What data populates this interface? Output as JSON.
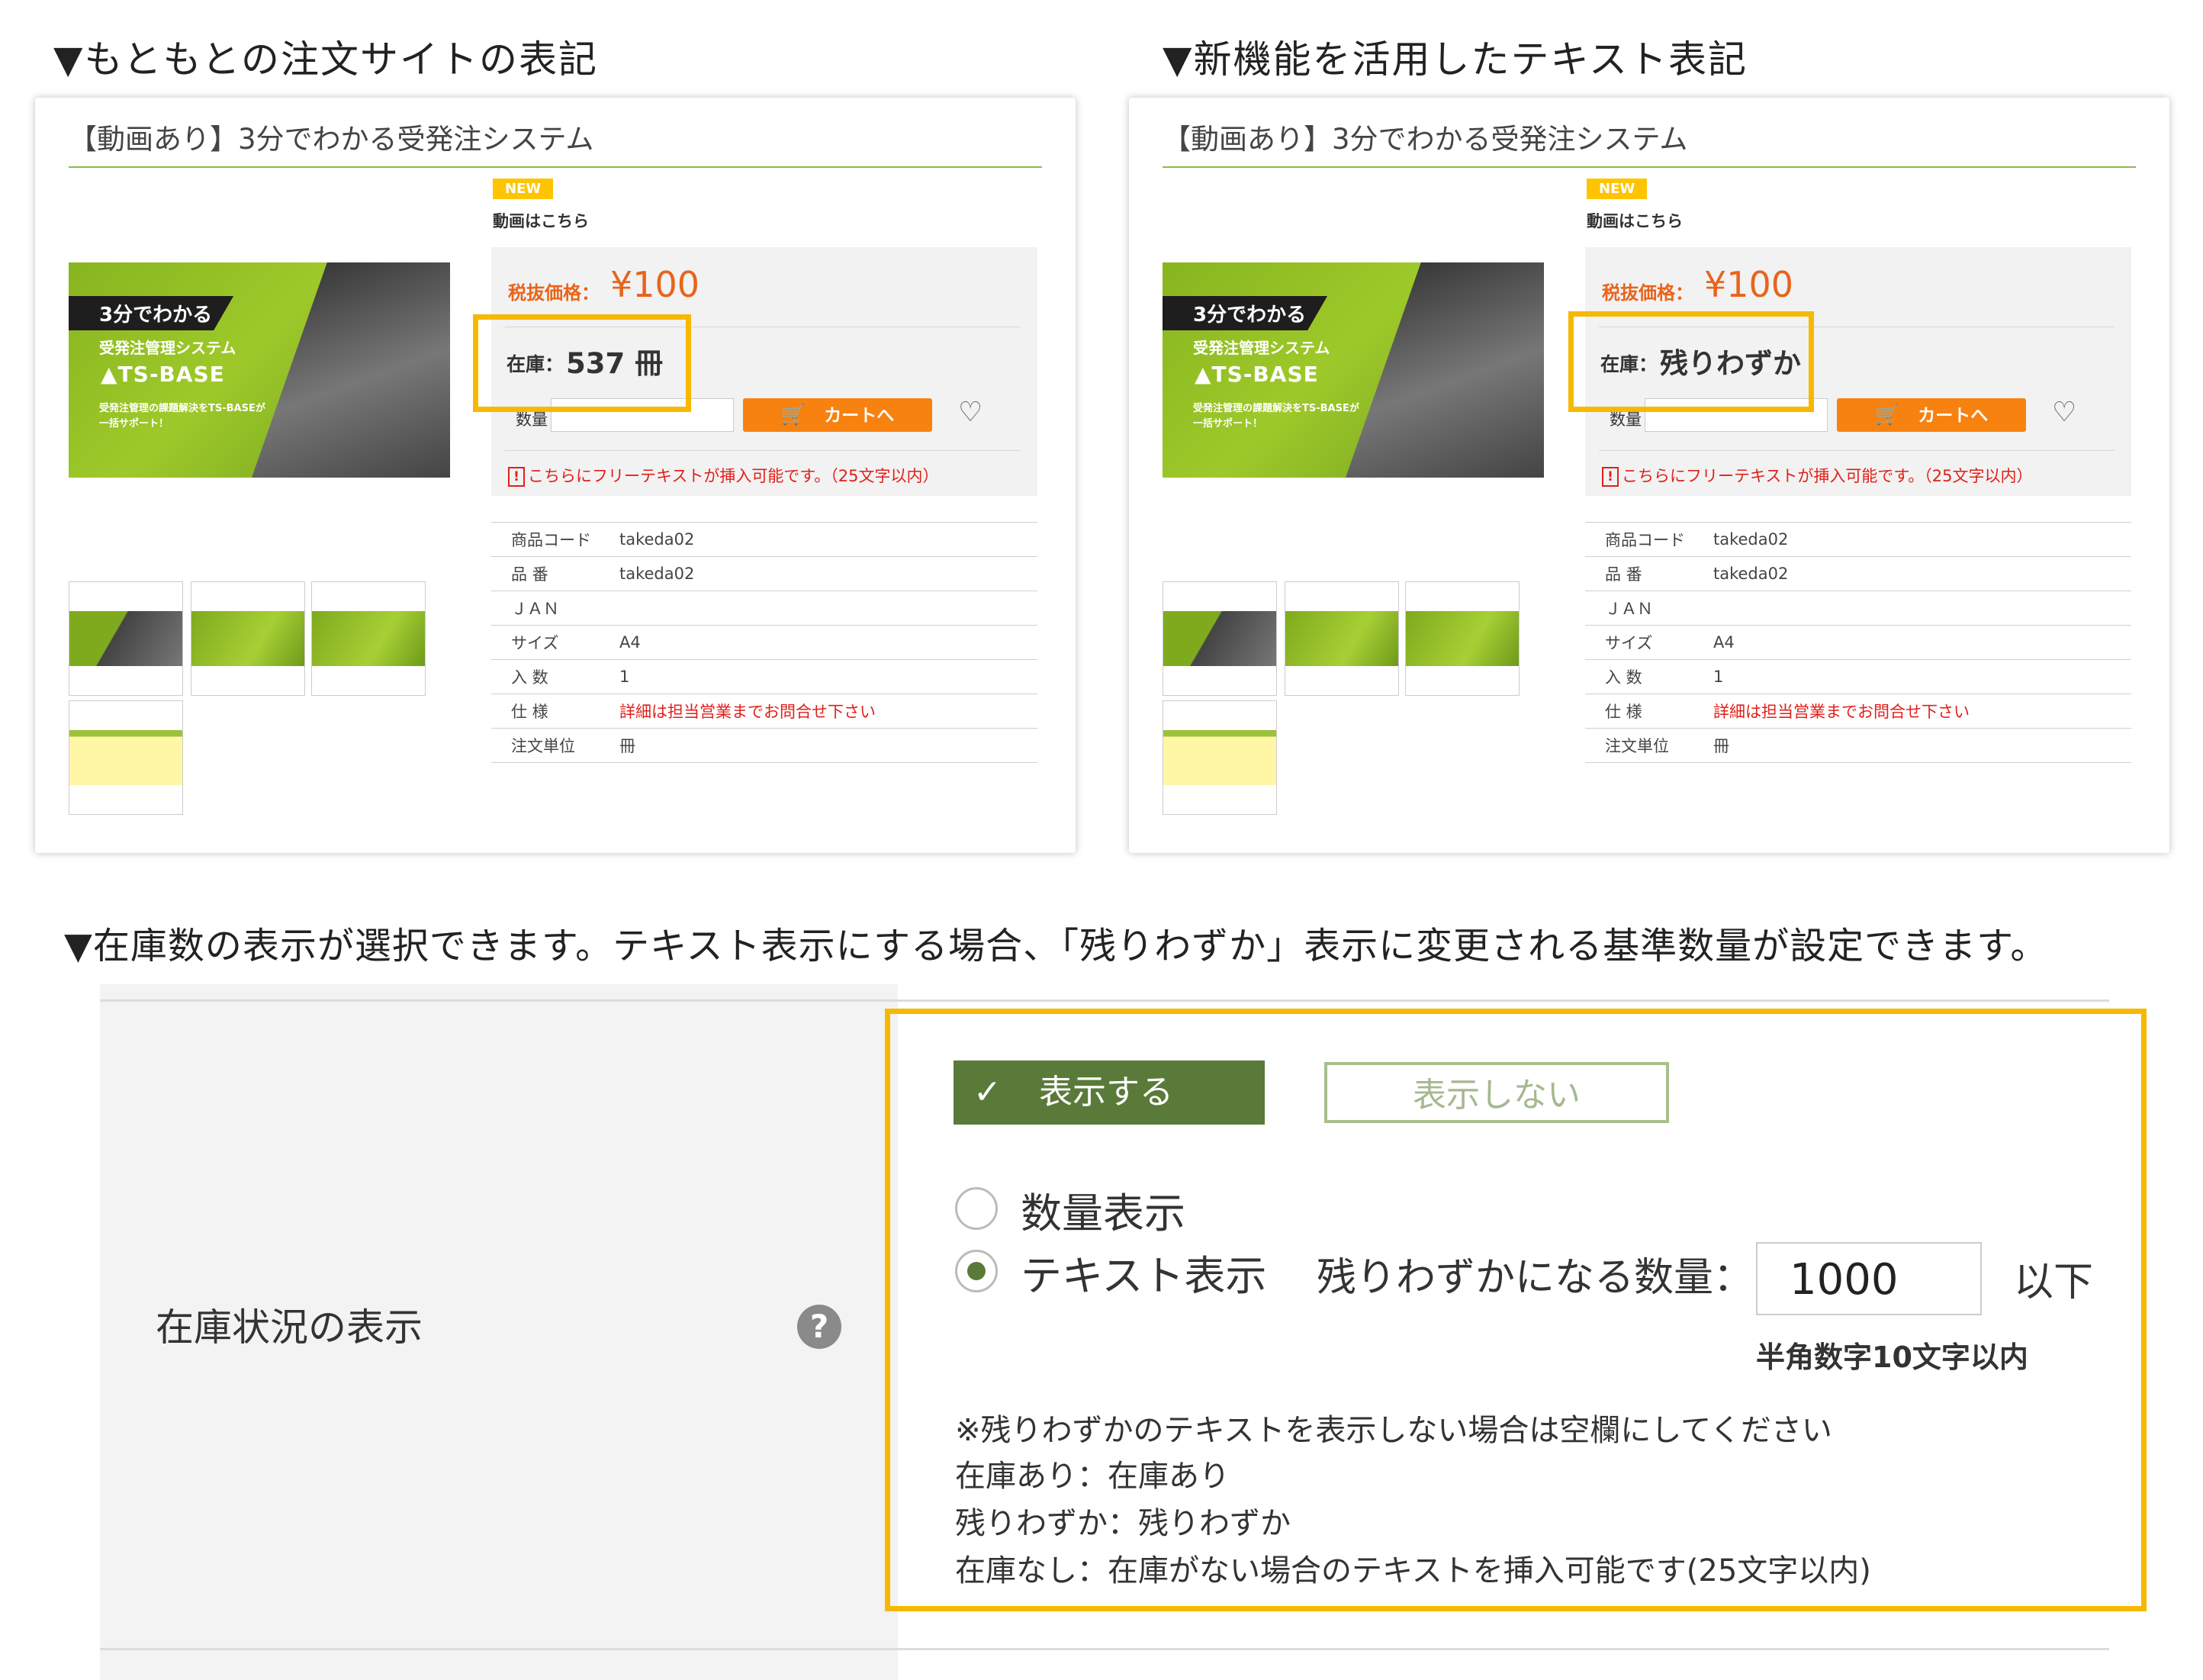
{
  "captions": {
    "original": "▼もともとの注文サイトの表記",
    "new_feature": "▼新機能を活用したテキスト表記",
    "settings": "▼在庫数の表示が選択できます。テキスト表示にする場合、「残りわずか」表示に変更される基準数量が設定できます。"
  },
  "product": {
    "title": "【動画あり】3分でわかる受発注システム",
    "badge": "NEW",
    "video_link": "動画はこちら",
    "price_label": "税抜価格：",
    "price": "¥100",
    "qty_label": "数量",
    "cart_button": "カートへ",
    "note": "こちらにフリーテキストが挿入可能です。（25文字以内）",
    "banner": {
      "tag": "3分でわかる",
      "title": "受発注管理システム",
      "logo": "TS-BASE",
      "sub": "受発注管理の課題解決をTS-BASEが一括サポート！"
    },
    "specs": [
      {
        "key": "商品コード",
        "value": "takeda02",
        "red": false
      },
      {
        "key": "品 番",
        "value": "takeda02",
        "red": false
      },
      {
        "key": "ＪＡＮ",
        "value": "",
        "red": false
      },
      {
        "key": "サイズ",
        "value": "A4",
        "red": false
      },
      {
        "key": "入 数",
        "value": "1",
        "red": false
      },
      {
        "key": "仕 様",
        "value": "詳細は担当営業までお問合せ下さい",
        "red": true
      },
      {
        "key": "注文単位",
        "value": "冊",
        "red": false
      }
    ]
  },
  "original_stock": {
    "label": "在庫：",
    "value": "537 冊"
  },
  "new_stock": {
    "label": "在庫：",
    "value": "残りわずか"
  },
  "settings": {
    "row_label": "在庫状況の表示",
    "show_button": "表示する",
    "hide_button": "表示しない",
    "option_quantity": "数量表示",
    "option_text": "テキスト表示",
    "selected_option": "テキスト表示",
    "threshold_label": "残りわずかになる数量：",
    "threshold_value": "1000",
    "threshold_suffix": "以下",
    "threshold_hint": "半角数字10文字以内",
    "help_lines": [
      "※残りわずかのテキストを表示しない場合は空欄にしてください",
      "在庫あり：在庫あり",
      "残りわずか：残りわずか",
      "在庫なし：在庫がない場合のテキストを挿入可能です(25文字以内)"
    ]
  },
  "colors": {
    "accent_green": "#5a7a3a",
    "highlight": "#f6b800",
    "price": "#e8641b",
    "cart": "#f7820f",
    "alert": "#e0201a"
  }
}
